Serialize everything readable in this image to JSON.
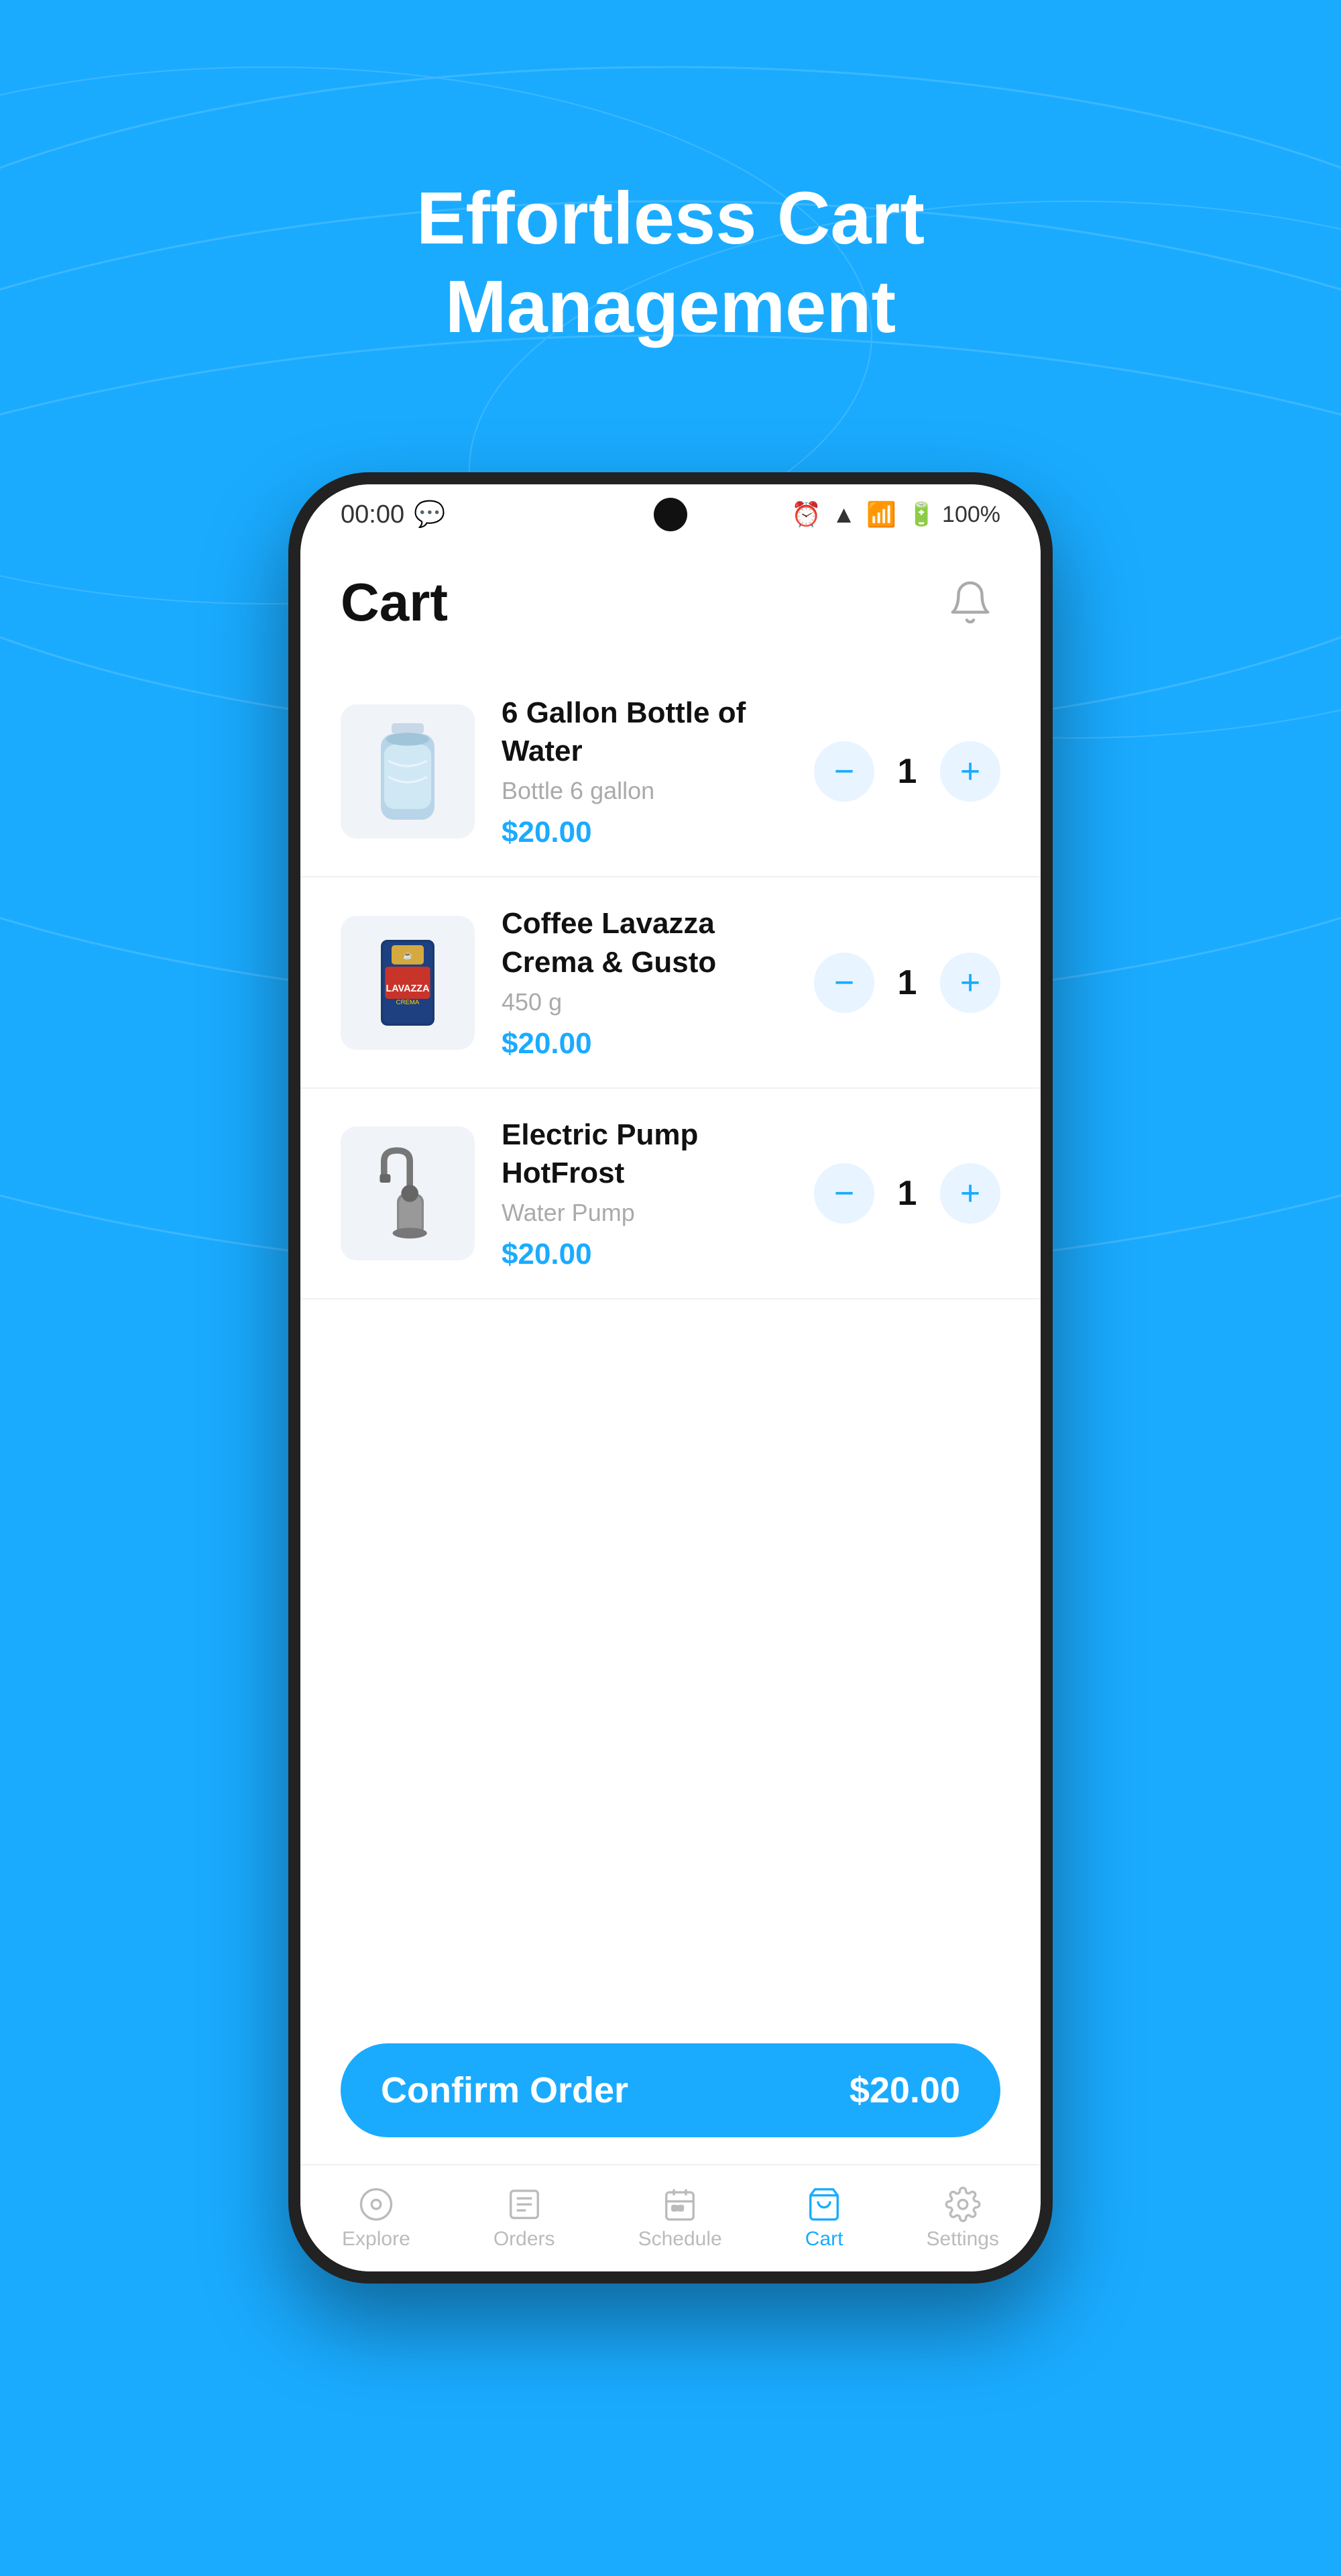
{
  "page": {
    "background_color": "#1aabff",
    "hero_title_line1": "Effortless Cart",
    "hero_title_line2": "Management"
  },
  "status_bar": {
    "time": "00:00",
    "battery": "100%"
  },
  "header": {
    "title": "Cart",
    "bell_label": "notifications"
  },
  "cart_items": [
    {
      "id": 1,
      "name": "6 Gallon Bottle of Water",
      "subtitle": "Bottle 6 gallon",
      "price": "$20.00",
      "quantity": 1,
      "icon": "🫙"
    },
    {
      "id": 2,
      "name": "Coffee Lavazza Crema & Gusto",
      "subtitle": "450 g",
      "price": "$20.00",
      "quantity": 1,
      "icon": "☕"
    },
    {
      "id": 3,
      "name": "Electric Pump HotFrost",
      "subtitle": "Water Pump",
      "price": "$20.00",
      "quantity": 1,
      "icon": "🔧"
    }
  ],
  "confirm_button": {
    "label": "Confirm Order",
    "price": "$20.00"
  },
  "bottom_nav": [
    {
      "id": "explore",
      "label": "Explore",
      "icon": "🔍",
      "active": false
    },
    {
      "id": "orders",
      "label": "Orders",
      "icon": "📋",
      "active": false
    },
    {
      "id": "schedule",
      "label": "Schedule",
      "icon": "📅",
      "active": false
    },
    {
      "id": "cart",
      "label": "Cart",
      "icon": "🛒",
      "active": true
    },
    {
      "id": "settings",
      "label": "Settings",
      "icon": "⚙️",
      "active": false
    }
  ]
}
